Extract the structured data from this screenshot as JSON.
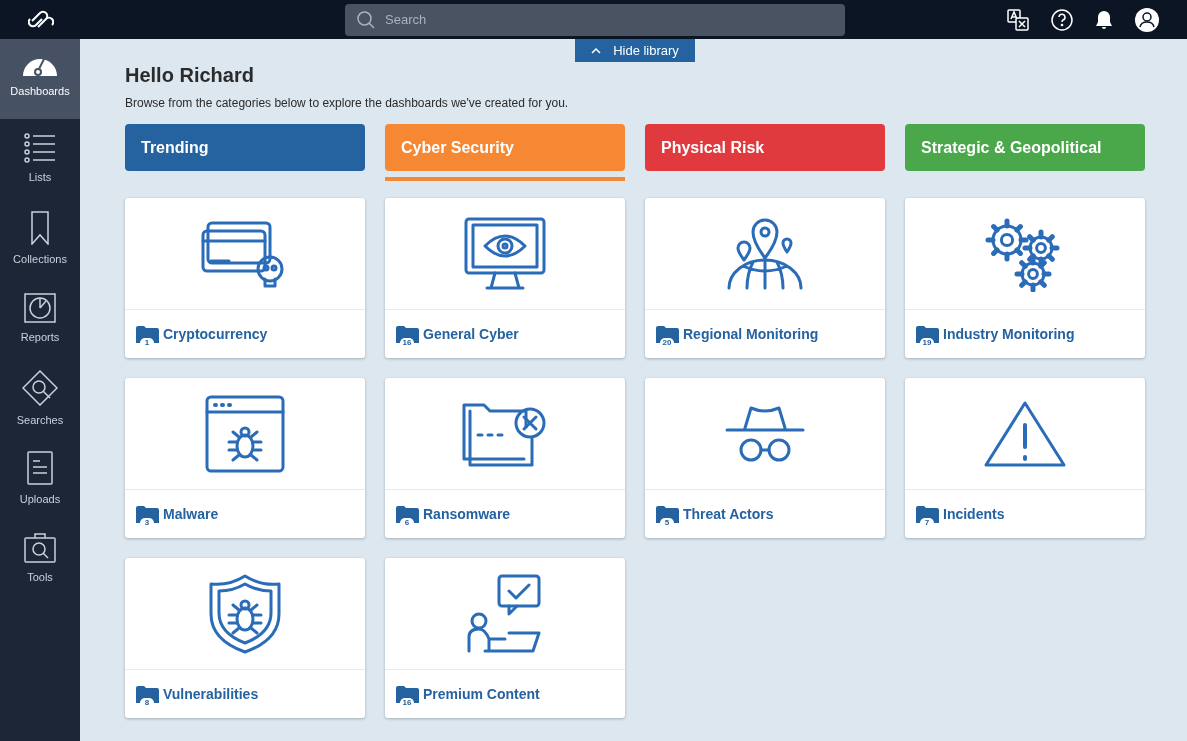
{
  "topbar": {
    "search": {
      "placeholder": "Search"
    }
  },
  "sidebar": {
    "items": [
      {
        "label": "Dashboards",
        "selected": true
      },
      {
        "label": "Lists",
        "selected": false
      },
      {
        "label": "Collections",
        "selected": false
      },
      {
        "label": "Reports",
        "selected": false
      },
      {
        "label": "Searches",
        "selected": false
      },
      {
        "label": "Uploads",
        "selected": false
      },
      {
        "label": "Tools",
        "selected": false
      }
    ]
  },
  "library_toggle": {
    "label": "Hide library"
  },
  "greeting": "Hello Richard",
  "subtitle": "Browse from the categories below to explore the dashboards we've created for you.",
  "categories": [
    {
      "label": "Trending",
      "color": "#2462a0",
      "selected": false
    },
    {
      "label": "Cyber Security",
      "color": "#f68733",
      "selected": true
    },
    {
      "label": "Physical Risk",
      "color": "#e0393e",
      "selected": false
    },
    {
      "label": "Strategic & Geopolitical",
      "color": "#4aa84a",
      "selected": false
    }
  ],
  "cards": [
    {
      "title": "Cryptocurrency",
      "count": "1"
    },
    {
      "title": "General Cyber",
      "count": "16"
    },
    {
      "title": "Regional Monitoring",
      "count": "20"
    },
    {
      "title": "Industry Monitoring",
      "count": "19"
    },
    {
      "title": "Malware",
      "count": "3"
    },
    {
      "title": "Ransomware",
      "count": "6"
    },
    {
      "title": "Threat Actors",
      "count": "5"
    },
    {
      "title": "Incidents",
      "count": "7"
    },
    {
      "title": "Vulnerabilities",
      "count": "8"
    },
    {
      "title": "Premium Content",
      "count": "16"
    }
  ]
}
